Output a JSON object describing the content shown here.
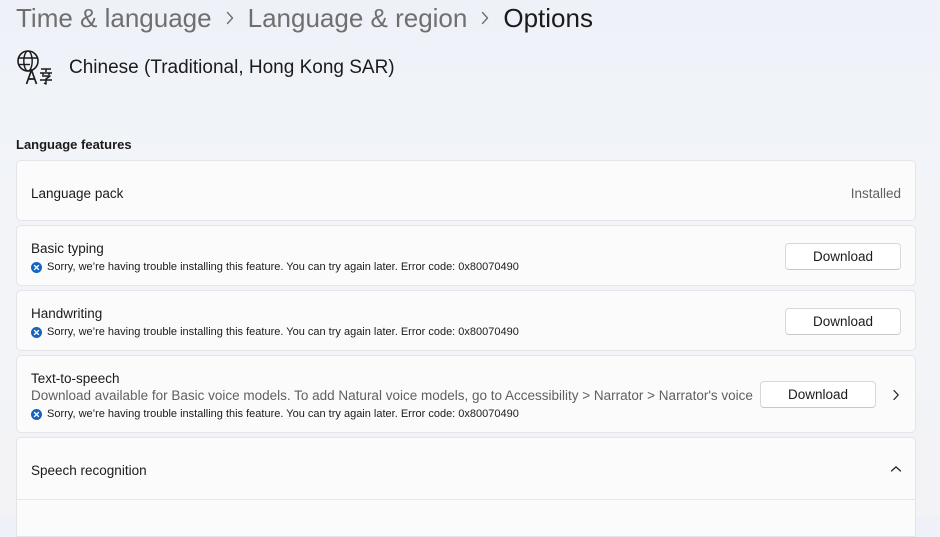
{
  "breadcrumb": {
    "items": [
      "Time & language",
      "Language & region",
      "Options"
    ]
  },
  "language": {
    "name": "Chinese (Traditional, Hong Kong SAR)",
    "icon": "language-translate-icon"
  },
  "section_title": "Language features",
  "features": {
    "language_pack": {
      "label": "Language pack",
      "status": "Installed"
    },
    "basic_typing": {
      "label": "Basic typing",
      "error": "Sorry, we’re having trouble installing this feature. You can try again later. Error code: 0x80070490",
      "button": "Download"
    },
    "handwriting": {
      "label": "Handwriting",
      "error": "Sorry, we’re having trouble installing this feature. You can try again later. Error code: 0x80070490",
      "button": "Download"
    },
    "text_to_speech": {
      "label": "Text-to-speech",
      "description": "Download available for Basic voice models. To add Natural voice models, go to Accessibility > Narrator > Narrator's voice",
      "error": "Sorry, we’re having trouble installing this feature. You can try again later. Error code: 0x80070490",
      "button": "Download"
    },
    "speech_recognition": {
      "label": "Speech recognition"
    }
  },
  "colors": {
    "error_icon": "#1565c0",
    "muted_text": "#606060"
  }
}
